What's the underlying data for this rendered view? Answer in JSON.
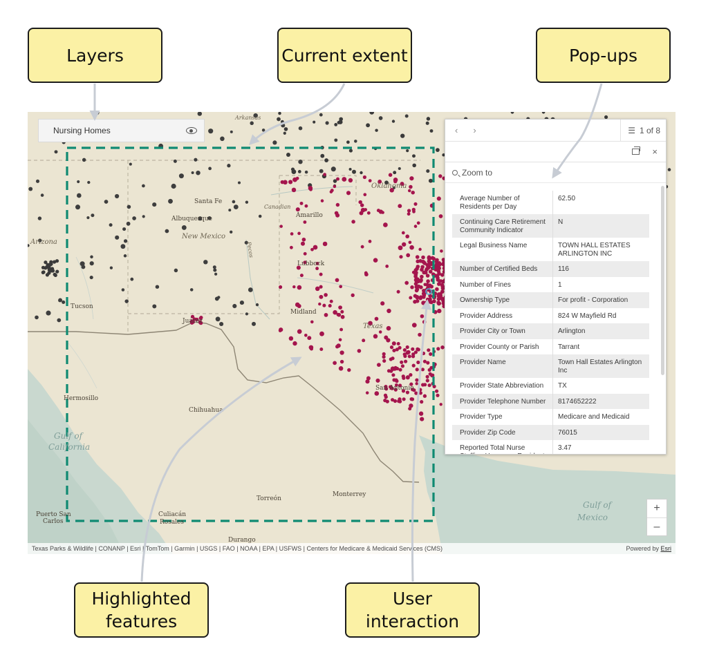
{
  "callouts": {
    "layers": "Layers",
    "current_extent": "Current extent",
    "popups": "Pop-ups",
    "highlighted_line1": "Highlighted",
    "highlighted_line2": "features",
    "user_line1": "User",
    "user_line2": "interaction"
  },
  "colors": {
    "callout_fill": "#fbf1a5",
    "extent_outline": "#0f8a72",
    "highlight_feature": "#a4154d",
    "default_feature": "#3a3a3a",
    "arrow": "#c7ccd4"
  },
  "layer_list": {
    "layer_name": "Nursing Homes",
    "visibility_icon": "eye-icon"
  },
  "map_labels": {
    "santa_fe": "Santa Fe",
    "albuquerque": "Albuquerque",
    "new_mexico": "New Mexico",
    "arizona": "Arizona",
    "amarillo": "Amarillo",
    "lubbock": "Lubbock",
    "midland": "Midland",
    "texas": "Texas",
    "tucson": "Tucson",
    "juarez": "Juárez",
    "hermosillo": "Hermosillo",
    "chihuahua": "Chihuahua",
    "gulf_of_california_1": "Gulf of",
    "gulf_of_california_2": "California",
    "torreon": "Torreón",
    "monterrey": "Monterrey",
    "puerto_san_carlos_1": "Puerto San",
    "puerto_san_carlos_2": "Carlos",
    "culiacan_1": "Culiacán",
    "culiacan_2": "Rosales",
    "durango": "Durango",
    "san_antonio": "San Antonio",
    "oklahoma": "Oklahoma",
    "gulf_of_mexico_1": "Gulf of",
    "gulf_of_mexico_2": "Mexico",
    "canadian": "Canadian",
    "pecos": "Pecos",
    "arkansas": "Arkansas"
  },
  "attribution": {
    "sources": "Texas Parks & Wildlife | CONANP | Esri | TomTom | Garmin | USGS | FAO | NOAA | EPA | USFWS | Centers for Medicare & Medicaid Services (CMS)",
    "powered_by": "Powered by",
    "esri": "Esri"
  },
  "zoom": {
    "in": "+",
    "out": "–"
  },
  "popup": {
    "prev": "‹",
    "next": "›",
    "count": "1 of 8",
    "close": "×",
    "zoom_to": "Zoom to",
    "rows": [
      {
        "label": "Average Number of Residents per Day",
        "value": "62.50"
      },
      {
        "label": "Continuing Care Retirement Community Indicator",
        "value": "N"
      },
      {
        "label": "Legal Business Name",
        "value": "TOWN HALL ESTATES ARLINGTON INC"
      },
      {
        "label": "Number of Certified Beds",
        "value": "116"
      },
      {
        "label": "Number of Fines",
        "value": "1"
      },
      {
        "label": "Ownership Type",
        "value": "For profit - Corporation"
      },
      {
        "label": "Provider Address",
        "value": "824 W Mayfield Rd"
      },
      {
        "label": "Provider City or Town",
        "value": "Arlington"
      },
      {
        "label": "Provider County or Parish",
        "value": "Tarrant"
      },
      {
        "label": "Provider Name",
        "value": "Town Hall Estates Arlington Inc"
      },
      {
        "label": "Provider State Abbreviation",
        "value": "TX"
      },
      {
        "label": "Provider Telephone Number",
        "value": "8174652222"
      },
      {
        "label": "Provider Type",
        "value": "Medicare and Medicaid"
      },
      {
        "label": "Provider Zip Code",
        "value": "76015"
      },
      {
        "label": "Reported Total Nurse Staffing Hours per Resident",
        "value": "3.47"
      }
    ]
  }
}
